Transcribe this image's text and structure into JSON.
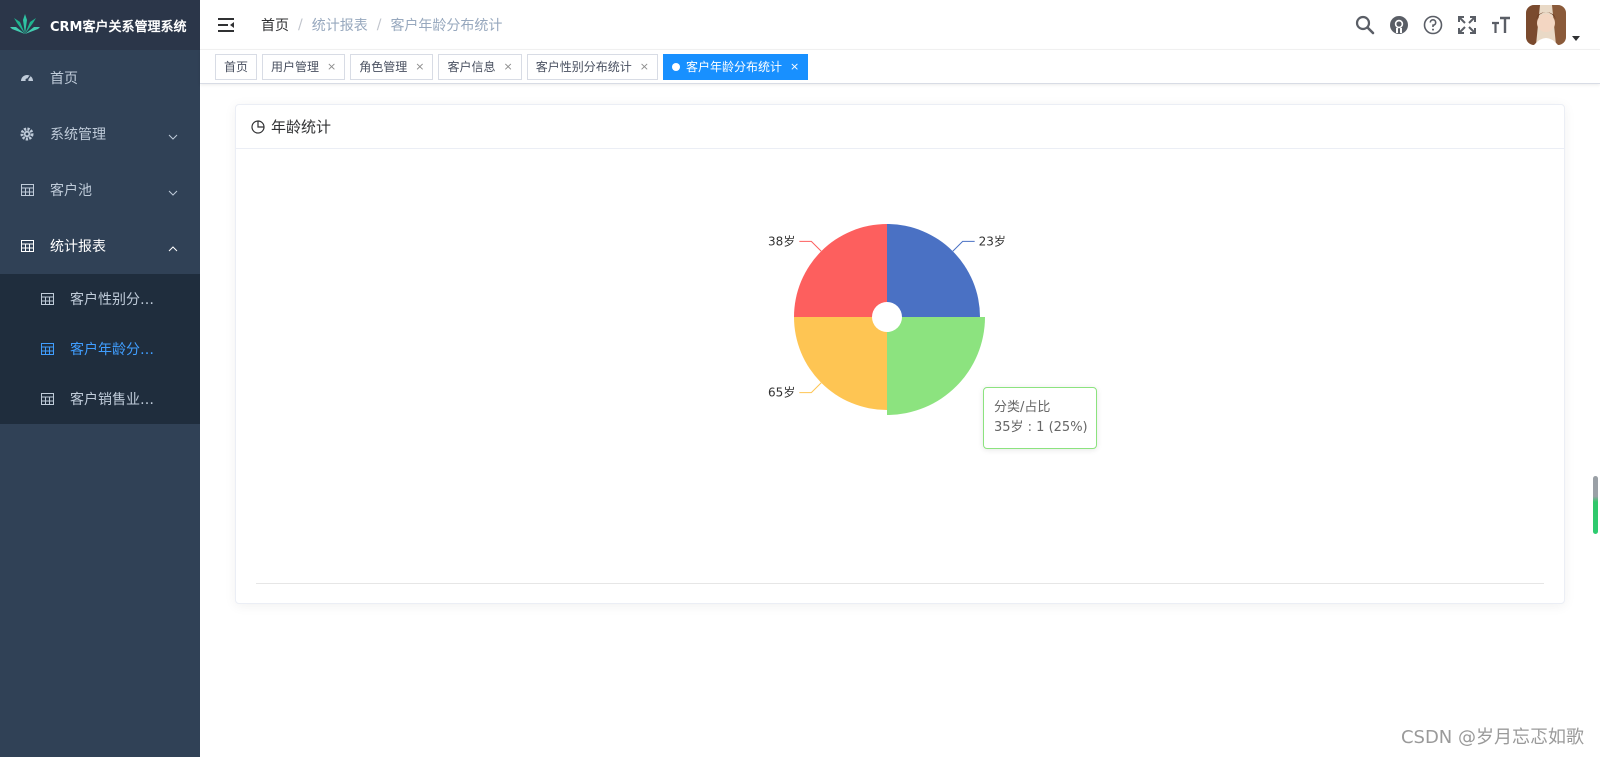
{
  "app": {
    "title": "CRM客户关系管理系统"
  },
  "sidebar": {
    "items": [
      {
        "label": "首页",
        "icon": "dashboard-icon"
      },
      {
        "label": "系统管理",
        "icon": "gear-icon"
      },
      {
        "label": "客户池",
        "icon": "table-icon"
      },
      {
        "label": "统计报表",
        "icon": "table-icon",
        "expanded": true
      }
    ],
    "subitems": [
      {
        "label": "客户性别分…",
        "icon": "table-icon"
      },
      {
        "label": "客户年龄分…",
        "icon": "table-icon",
        "active": true
      },
      {
        "label": "客户销售业…",
        "icon": "table-icon"
      }
    ]
  },
  "breadcrumb": [
    "首页",
    "统计报表",
    "客户年龄分布统计"
  ],
  "tabs": [
    {
      "label": "首页"
    },
    {
      "label": "用户管理",
      "close": "×"
    },
    {
      "label": "角色管理",
      "close": "×"
    },
    {
      "label": "客户信息",
      "close": "×"
    },
    {
      "label": "客户性别分布统计",
      "close": "×"
    },
    {
      "label": "客户年龄分布统计",
      "close": "×",
      "active": true
    }
  ],
  "card": {
    "title": "年龄统计"
  },
  "chart_data": {
    "type": "pie",
    "slices": [
      {
        "label": "23岁",
        "value": 1,
        "color": "#4a71c4"
      },
      {
        "label": "35岁",
        "value": 1,
        "color": "#8ce37f"
      },
      {
        "label": "65岁",
        "value": 1,
        "color": "#fec553"
      },
      {
        "label": "38岁",
        "value": 1,
        "color": "#fd5f5e"
      }
    ],
    "highlighted": "35岁"
  },
  "tooltip": {
    "title": "分类/占比",
    "content": "35岁 : 1 (25%)"
  },
  "watermark": "CSDN @岁月忘忑如歌",
  "colors": {
    "sidebar": "#304156",
    "submenu": "#1f2d3d",
    "accent": "#409eff",
    "tag_active": "#1890ff"
  }
}
